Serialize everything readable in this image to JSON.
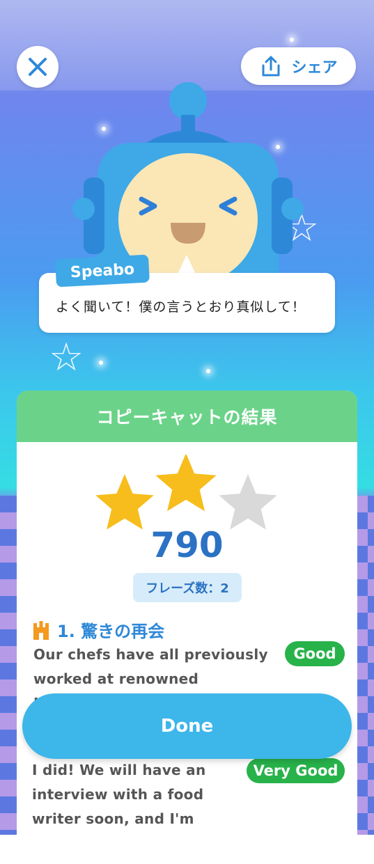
{
  "header": {
    "share_label": "シェア"
  },
  "character": {
    "name": "Speabo",
    "speech": "よく聞いて！僕の言うとおり真似して！"
  },
  "result": {
    "title": "コピーキャットの結果",
    "stars_earned": 2,
    "stars_total": 3,
    "score": "790",
    "phrase_count": "フレーズ数：2",
    "items": [
      {
        "title": "1. 驚きの再会",
        "icon": "castle-icon",
        "text": "Our chefs have all previously worked at renowned Japanese",
        "rating": "Good"
      },
      {
        "text": "I did! We will have an interview with a food writer soon, and I'm",
        "rating": "Very Good"
      }
    ]
  },
  "footer": {
    "done_label": "Done"
  },
  "colors": {
    "accent_blue": "#3db6ea",
    "header_green": "#6bd389",
    "badge_green": "#27b24a",
    "score_blue": "#2b72c4",
    "star_gold": "#f7bd1c",
    "star_gray": "#d9d9d9"
  }
}
